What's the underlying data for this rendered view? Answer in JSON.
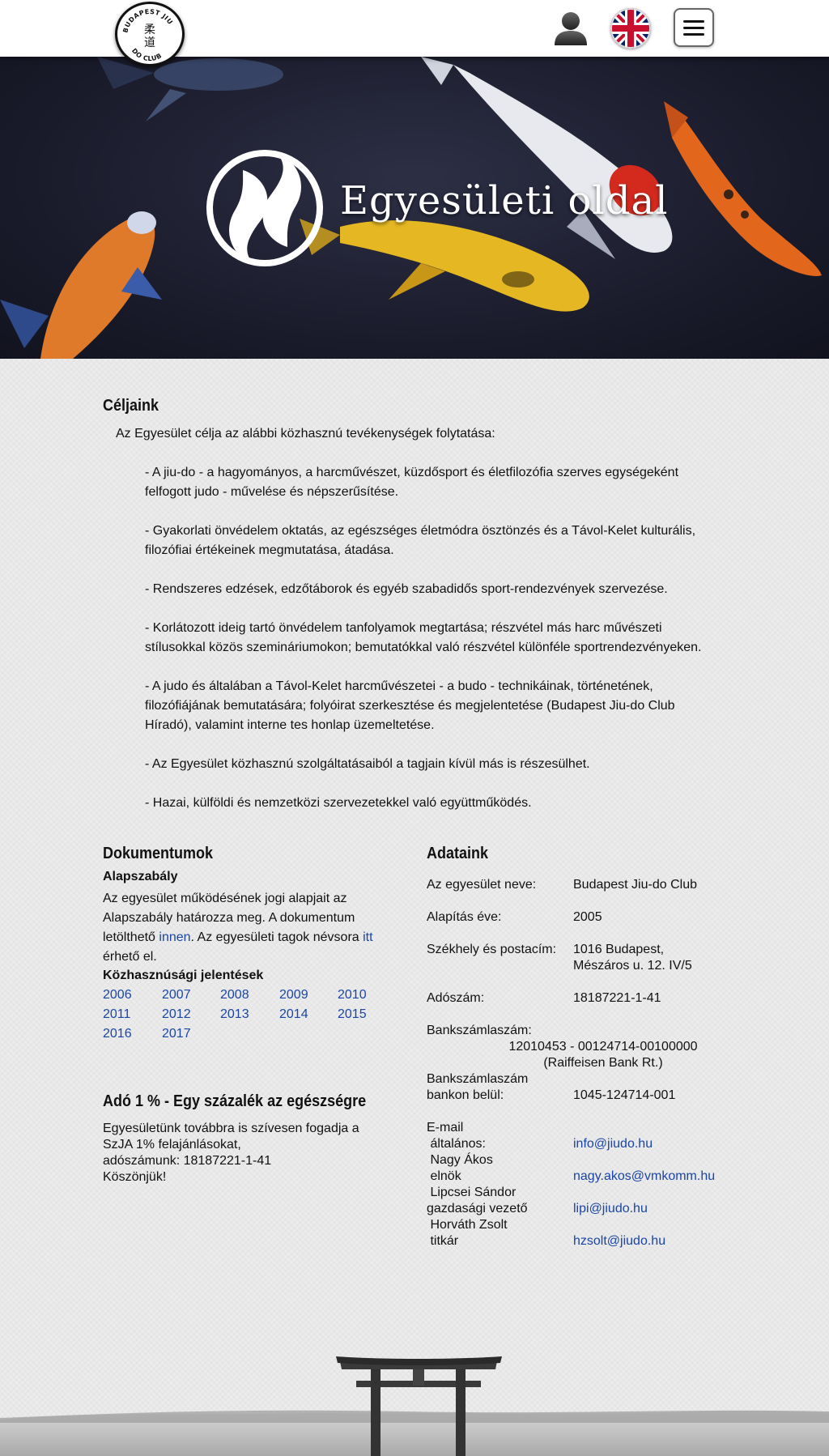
{
  "header": {
    "logo_text": "BUDAPEST JIU-DO CLUB",
    "profile_icon": "user-silhouette-icon",
    "language_icon": "uk-flag-icon",
    "menu_icon": "hamburger-menu-icon"
  },
  "hero": {
    "title": "Egyesületi oldal"
  },
  "goals": {
    "title": "Céljaink",
    "intro": "Az Egyesület célja az alábbi közhasznú tevékenységek folytatása:",
    "items": [
      "- A jiu-do - a hagyományos, a harcművészet, küzdősport és életfilozófia szerves egységeként felfogott judo - művelése és népszerűsítése.",
      "- Gyakorlati önvédelem oktatás, az egészséges életmódra ösztönzés és a Távol-Kelet kulturális, filozófiai értékeinek megmutatása, átadása.",
      "- Rendszeres edzések, edzőtáborok és egyéb szabadidős sport-rendezvények szervezése.",
      "- Korlátozott ideig tartó önvédelem tanfolyamok megtartása; részvétel más harc művészeti stílusokkal közös szemináriumokon; bemutatókkal való részvétel különféle sportrendezvényeken.",
      "- A judo és általában a Távol-Kelet harcművészetei - a budo - technikáinak, történetének, filozófiájának bemutatására; folyóirat szerkesztése és megjelentetése (Budapest Jiu-do Club Híradó), valamint interne tes honlap üzemeltetése.",
      "- Az Egyesület közhasznú szolgáltatásaiból a tagjain kívül más is részesülhet.",
      "- Hazai, külföldi és nemzetközi szervezetekkel való együttműködés."
    ]
  },
  "documents": {
    "title": "Dokumentumok",
    "subtitle": "Alapszabály",
    "text_1": "Az egyesület működésének jogi alapjait az Alapszabály határozza meg. A dokumentum letölthető ",
    "link_1": "innen",
    "text_2": ". Az egyesületi tagok névsora ",
    "link_2": "itt",
    "text_3": " érhető el.",
    "reports_title": "Közhasznúsági jelentések",
    "years": [
      "2006",
      "2007",
      "2008",
      "2009",
      "2010",
      "2011",
      "2012",
      "2013",
      "2014",
      "2015",
      "2016",
      "2017"
    ]
  },
  "ado": {
    "title": "Adó 1 % - Egy százalék az egészségre",
    "lines": [
      "Egyesületünk továbbra is szívesen fogadja a",
      "SzJA 1% felajánlásokat,",
      "adószámunk: 18187221-1-41",
      "Köszönjük!"
    ]
  },
  "data": {
    "title": "Adataink",
    "name_label": "Az egyesület neve:",
    "name_value": "Budapest Jiu-do Club",
    "founded_label": "Alapítás éve:",
    "founded_value": "2005",
    "address_label": "Székhely és postacím:",
    "address_line1": "1016 Budapest,",
    "address_line2": "Mészáros u. 12. IV/5",
    "tax_label": "Adószám:",
    "tax_value": "18187221-1-41",
    "bank_label": "Bankszámlaszám:",
    "bank_value": "12010453 - 00124714-00100000",
    "bank_name": "(Raiffeisen Bank Rt.)",
    "internal_label_1": "Bankszámlaszám",
    "internal_label_2": "bankon belül:",
    "internal_value": "1045-124714-001",
    "email_label": "E-mail",
    "general_label": " általános:",
    "general_email": "info@jiudo.hu",
    "person_1": " Nagy Ákos",
    "role_1": " elnök",
    "email_1": "nagy.akos@vmkomm.hu",
    "person_2": " Lipcsei Sándor",
    "role_2": "gazdasági vezető",
    "email_2": "lipi@jiudo.hu",
    "person_3": " Horváth Zsolt",
    "role_3": " titkár",
    "email_3": "hzsolt@jiudo.hu"
  },
  "colors": {
    "link": "#1a45a6",
    "hero_bg": "#1b1c2c"
  }
}
